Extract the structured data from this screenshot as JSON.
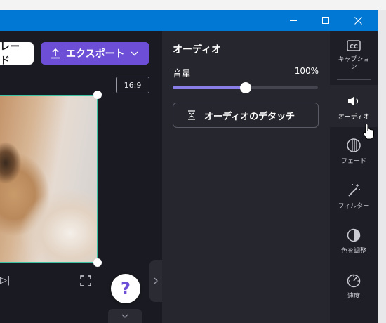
{
  "window": {
    "controls": {
      "minimize": "minimize-icon",
      "maximize": "maximize-icon",
      "close": "close-icon"
    }
  },
  "editor": {
    "prev_button_label": "レード",
    "export_button_label": "エクスポート",
    "aspect_ratio": "16:9",
    "help_label": "?"
  },
  "audio_panel": {
    "title": "オーディオ",
    "volume_label": "音量",
    "volume_value": "100%",
    "volume_fraction": 0.5,
    "detach_label": "オーディオのデタッチ"
  },
  "toolbar": {
    "items": [
      {
        "label": "キャプション",
        "icon": "cc-icon"
      },
      {
        "label": "オーディオ",
        "icon": "speaker-icon",
        "active": true
      },
      {
        "label": "フェード",
        "icon": "fade-icon"
      },
      {
        "label": "フィルター",
        "icon": "magic-wand-icon"
      },
      {
        "label": "色を調整",
        "icon": "contrast-icon"
      },
      {
        "label": "速度",
        "icon": "speedometer-icon"
      }
    ]
  },
  "colors": {
    "accent": "#6c4fd6",
    "selection": "#3fc1a4",
    "titlebar": "#0078d4",
    "panel": "#25262e"
  }
}
